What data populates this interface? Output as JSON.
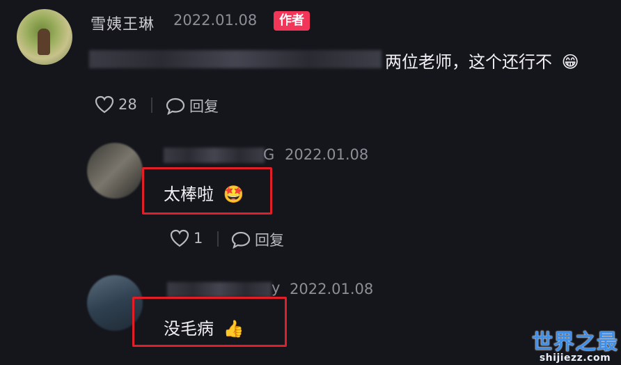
{
  "comment1": {
    "author": "雪姨王琳",
    "date": "2022.01.08",
    "badge": "作者",
    "text": "两位老师，这个还行不",
    "emoji": "😁",
    "likes": "28",
    "reply_label": "回复"
  },
  "reply1": {
    "author_visible": "G",
    "date": "2022.01.08",
    "text": "太棒啦",
    "emoji": "🤩",
    "likes": "1",
    "reply_label": "回复"
  },
  "reply2": {
    "author_visible": "y",
    "date": "2022.01.08",
    "text": "没毛病",
    "emoji": "👍"
  },
  "watermark": {
    "cn": "世界之最",
    "en": "shijiezz.com"
  },
  "colors": {
    "background": "#15161c",
    "badge": "#f2365a",
    "highlight_box": "#e21f26"
  }
}
